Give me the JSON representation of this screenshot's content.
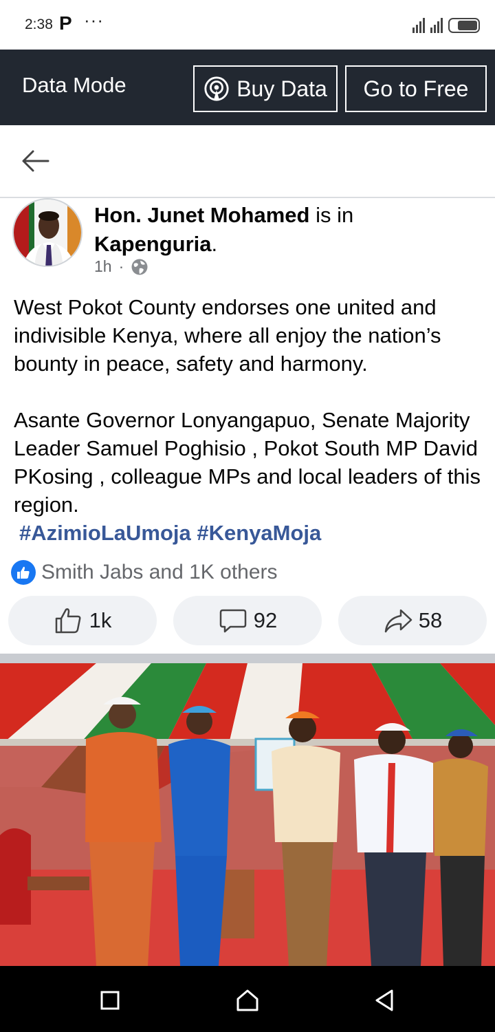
{
  "status_bar": {
    "time": "2:38",
    "app_glyph": "P",
    "overflow": "···",
    "icons": [
      "signal-icon",
      "signal-icon",
      "battery-icon"
    ]
  },
  "data_bar": {
    "title": "Data Mode",
    "buy_label": "Buy Data",
    "free_label": "Go to Free"
  },
  "post": {
    "author": "Hon. Junet Mohamed",
    "is_in": " is in ",
    "location": "Kapenguria",
    "location_suffix": ".",
    "time": "1h",
    "separator": "·",
    "paragraph1": "West Pokot County endorses one united and indivisible Kenya, where all enjoy the nation’s bounty in peace, safety and harmony.",
    "paragraph2": "Asante Governor Lonyangapuo, Senate Majority Leader Samuel Poghisio , Pokot South MP David PKosing ,  colleague MPs and local leaders of this region.",
    "hashtags": "#AzimioLaUmoja #KenyaMoja"
  },
  "reactions": {
    "summary": "Smith Jabs and 1K others"
  },
  "actions": {
    "like_count": "1k",
    "comment_count": "92",
    "share_count": "58"
  },
  "colors": {
    "data_bar": "#222831",
    "link": "#385898",
    "like_blue": "#1877f2",
    "action_bg": "#f0f2f5"
  }
}
